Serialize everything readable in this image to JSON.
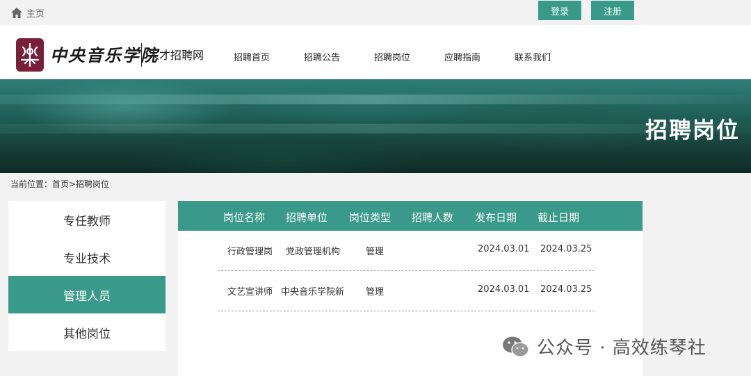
{
  "topbar": {
    "home_label": "主页",
    "login_label": "登录",
    "register_label": "注册",
    "accent": "#3a9a8a"
  },
  "header": {
    "logo_name": "中央音乐学院",
    "logo_sub": "人才招聘网",
    "nav": [
      "招聘首页",
      "招聘公告",
      "招聘岗位",
      "应聘指南",
      "联系我们"
    ]
  },
  "banner": {
    "title": "招聘岗位"
  },
  "breadcrumb": "当前位置：首页>招聘岗位",
  "sidebar": {
    "items": [
      "专任教师",
      "专业技术",
      "管理人员",
      "其他岗位"
    ],
    "active": "管理人员"
  },
  "table": {
    "headers": [
      "岗位名称",
      "招聘单位",
      "岗位类型",
      "招聘人数",
      "发布日期",
      "截止日期"
    ],
    "rows": [
      [
        "行政管理岗",
        "党政管理机构",
        "管理",
        "",
        "2024.03.01",
        "2024.03.25"
      ],
      [
        "文艺宣讲师",
        "中央音乐学院新",
        "管理",
        "",
        "2024.03.01",
        "2024.03.25"
      ]
    ]
  },
  "watermark": "公众号 · 高效练琴社"
}
